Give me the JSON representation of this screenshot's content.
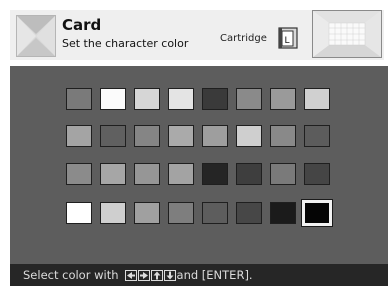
{
  "header": {
    "title": "Card",
    "subtitle": "Set the character color",
    "cartridge_label": "Cartridge",
    "cartridge_icon": "cartridge-l-icon",
    "card_icon": "card-envelope-icon"
  },
  "palette": {
    "rows": [
      [
        "#7a7a7a",
        "#fbfbfb",
        "#d6d6d6",
        "#e4e4e4",
        "#3a3a3a",
        "#8a8a8a",
        "#9a9a9a",
        "#d0d0d0"
      ],
      [
        "#a4a4a4",
        "#606060",
        "#858585",
        "#aaaaaa",
        "#9e9e9e",
        "#cfcfcf",
        "#898989",
        "#5c5c5c"
      ],
      [
        "#8b8b8b",
        "#a6a6a6",
        "#969696",
        "#a3a3a3",
        "#252525",
        "#3e3e3e",
        "#7a7a7a",
        "#454545"
      ],
      [
        "#ffffff",
        "#cfcfcf",
        "#a0a0a0",
        "#7e7e7e",
        "#5d5d5d",
        "#474747",
        "#1b1b1b",
        "#050505"
      ]
    ],
    "selected": {
      "row": 3,
      "col": 7
    }
  },
  "status": {
    "prefix": "Select color with",
    "suffix": "and [ENTER].",
    "arrow_icons": [
      "left-arrow-icon",
      "right-arrow-icon",
      "up-arrow-icon",
      "down-arrow-icon"
    ]
  }
}
